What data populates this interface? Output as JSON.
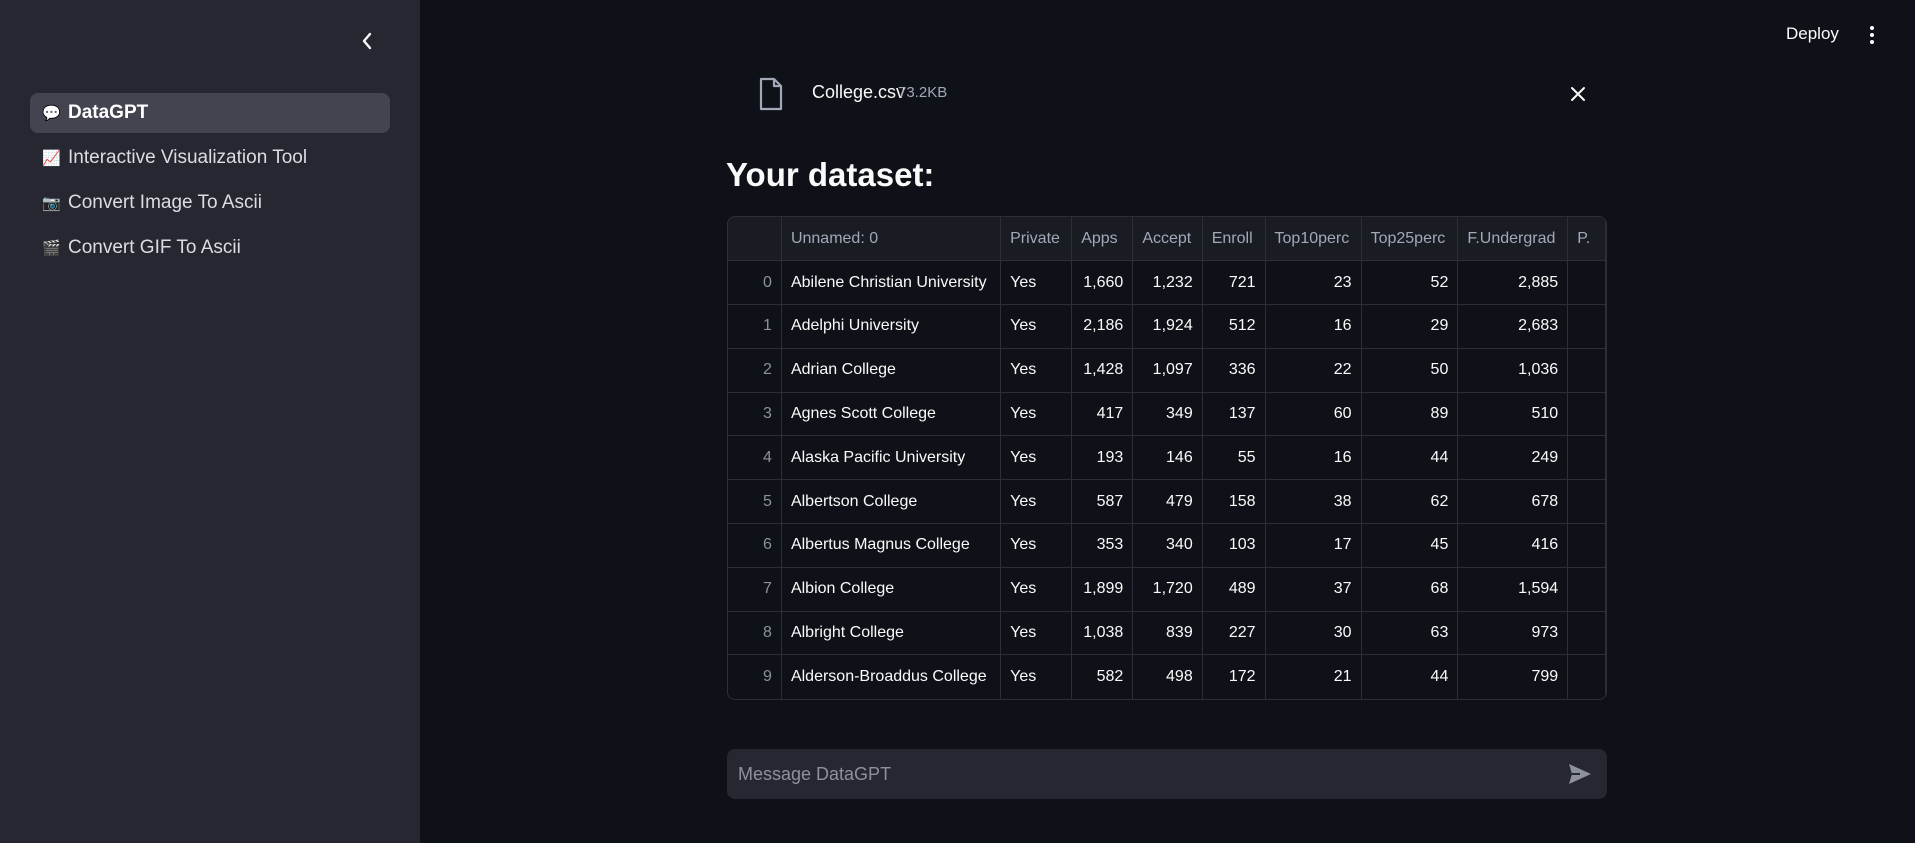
{
  "sidebar": {
    "items": [
      {
        "emoji": "💬",
        "label": "DataGPT",
        "active": true
      },
      {
        "emoji": "📈",
        "label": "Interactive Visualization Tool",
        "active": false
      },
      {
        "emoji": "📷",
        "label": "Convert Image To Ascii",
        "active": false
      },
      {
        "emoji": "🎬",
        "label": "Convert GIF To Ascii",
        "active": false
      }
    ]
  },
  "header": {
    "deploy_label": "Deploy"
  },
  "file": {
    "name": "College.csv",
    "size": "73.2KB"
  },
  "main": {
    "heading": "Your dataset:"
  },
  "table": {
    "columns": [
      "",
      "Unnamed: 0",
      "Private",
      "Apps",
      "Accept",
      "Enroll",
      "Top10perc",
      "Top25perc",
      "F.Undergrad",
      "P."
    ],
    "rows": [
      [
        "0",
        "Abilene Christian University",
        "Yes",
        "1,660",
        "1,232",
        "721",
        "23",
        "52",
        "2,885",
        ""
      ],
      [
        "1",
        "Adelphi University",
        "Yes",
        "2,186",
        "1,924",
        "512",
        "16",
        "29",
        "2,683",
        ""
      ],
      [
        "2",
        "Adrian College",
        "Yes",
        "1,428",
        "1,097",
        "336",
        "22",
        "50",
        "1,036",
        ""
      ],
      [
        "3",
        "Agnes Scott College",
        "Yes",
        "417",
        "349",
        "137",
        "60",
        "89",
        "510",
        ""
      ],
      [
        "4",
        "Alaska Pacific University",
        "Yes",
        "193",
        "146",
        "55",
        "16",
        "44",
        "249",
        ""
      ],
      [
        "5",
        "Albertson College",
        "Yes",
        "587",
        "479",
        "158",
        "38",
        "62",
        "678",
        ""
      ],
      [
        "6",
        "Albertus Magnus College",
        "Yes",
        "353",
        "340",
        "103",
        "17",
        "45",
        "416",
        ""
      ],
      [
        "7",
        "Albion College",
        "Yes",
        "1,899",
        "1,720",
        "489",
        "37",
        "68",
        "1,594",
        ""
      ],
      [
        "8",
        "Albright College",
        "Yes",
        "1,038",
        "839",
        "227",
        "30",
        "63",
        "973",
        ""
      ],
      [
        "9",
        "Alderson-Broaddus College",
        "Yes",
        "582",
        "498",
        "172",
        "21",
        "44",
        "799",
        ""
      ]
    ]
  },
  "chat": {
    "placeholder": "Message DataGPT",
    "value": ""
  }
}
